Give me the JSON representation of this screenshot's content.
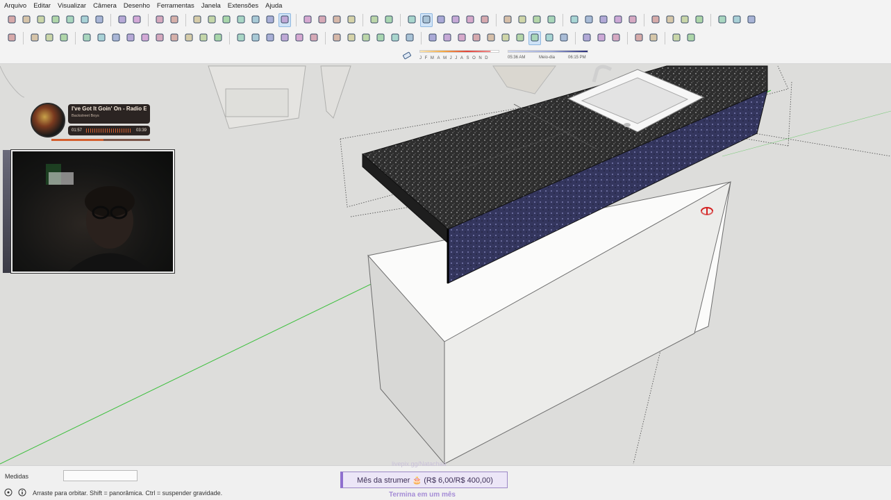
{
  "menu": [
    "Arquivo",
    "Editar",
    "Visualizar",
    "Câmera",
    "Desenho",
    "Ferramentas",
    "Janela",
    "Extensões",
    "Ajuda"
  ],
  "toolbar1": [
    "new-file-icon",
    "open-file-icon",
    "save-icon",
    "cut-icon",
    "copy-icon",
    "paste-icon",
    "erase-icon",
    "undo-icon",
    "redo-icon",
    "print-icon",
    "model-info-icon",
    "iso-view-icon",
    "top-view-icon",
    "front-view-icon",
    "right-view-icon",
    "back-view-icon",
    "left-view-icon",
    "bottom-view-icon",
    "xray-icon",
    "back-edges-icon",
    "wireframe-icon",
    "hidden-line-icon",
    "shaded-icon",
    "shaded-textures-icon",
    "monochrome-icon",
    "section-plane-icon",
    "display-sections-icon",
    "section-cuts-icon",
    "section-fill-icon",
    "tag-tool-icon",
    "group-icon",
    "component-icon",
    "add-location-icon",
    "photo-textures-icon",
    "sandbox-icon",
    "3d-warehouse-icon",
    "extension-warehouse-icon",
    "layout-icon",
    "style-builder-icon",
    "extension-manager-icon",
    "share-model-icon",
    "trimble-connect-icon",
    "settings-icon",
    "help-icon",
    "shop-icon",
    "account-icon"
  ],
  "toolbar2": [
    "select-icon",
    "make-component-icon",
    "paint-bucket-icon",
    "eraser-icon",
    "line-icon",
    "freehand-icon",
    "rectangle-icon",
    "rotated-rectangle-icon",
    "circle-icon",
    "polygon-icon",
    "arc-icon",
    "2pt-arc-icon",
    "3pt-arc-icon",
    "pie-icon",
    "move-icon",
    "push-pull-icon",
    "rotate-icon",
    "follow-me-icon",
    "scale-icon",
    "offset-icon",
    "tape-measure-icon",
    "dimension-icon",
    "protractor-icon",
    "text-icon",
    "axes-icon",
    "3d-text-icon",
    "orbit-icon",
    "pan-icon",
    "zoom-icon",
    "zoom-window-icon",
    "zoom-extents-icon",
    "previous-view-icon",
    "position-camera-icon",
    "look-around-icon",
    "walk-icon",
    "section-plane-tool-icon",
    "solid-tools-icon",
    "intersect-icon",
    "trim-icon",
    "mirror-icon",
    "curviloft-icon",
    "dimension-style-icon",
    "more-icon"
  ],
  "timeline": {
    "months": [
      "J",
      "F",
      "M",
      "A",
      "M",
      "J",
      "J",
      "A",
      "S",
      "O",
      "N",
      "D"
    ],
    "time_start": "05:36 AM",
    "time_mid": "Meio-dia",
    "time_end": "06:15 PM"
  },
  "music": {
    "title": "I've Got It Goin' On - Radio Edi",
    "artist": "Backstreet Boys",
    "elapsed": "01:57",
    "duration": "03:39",
    "progress": 0.53
  },
  "status": {
    "measure_label": "Medidas",
    "measure_value": "",
    "hint": "Arraste para orbitar. Shift = panorâmica. Ctrl = suspender gravidade.",
    "goal_text": "Mês da strumer 🎂 (R$ 6,00/R$ 400,00)",
    "goal_sub": "Termina em um mês",
    "goal_faint": "livepix.gg/Natachaa"
  },
  "colors": {
    "accent_blue": "#cfe3f7",
    "granite_dark": "#2c2c2c",
    "granite_edge": "#3d3f6e",
    "goal_purple": "#8f6fcf",
    "axis_green": "#3bbf3b"
  }
}
